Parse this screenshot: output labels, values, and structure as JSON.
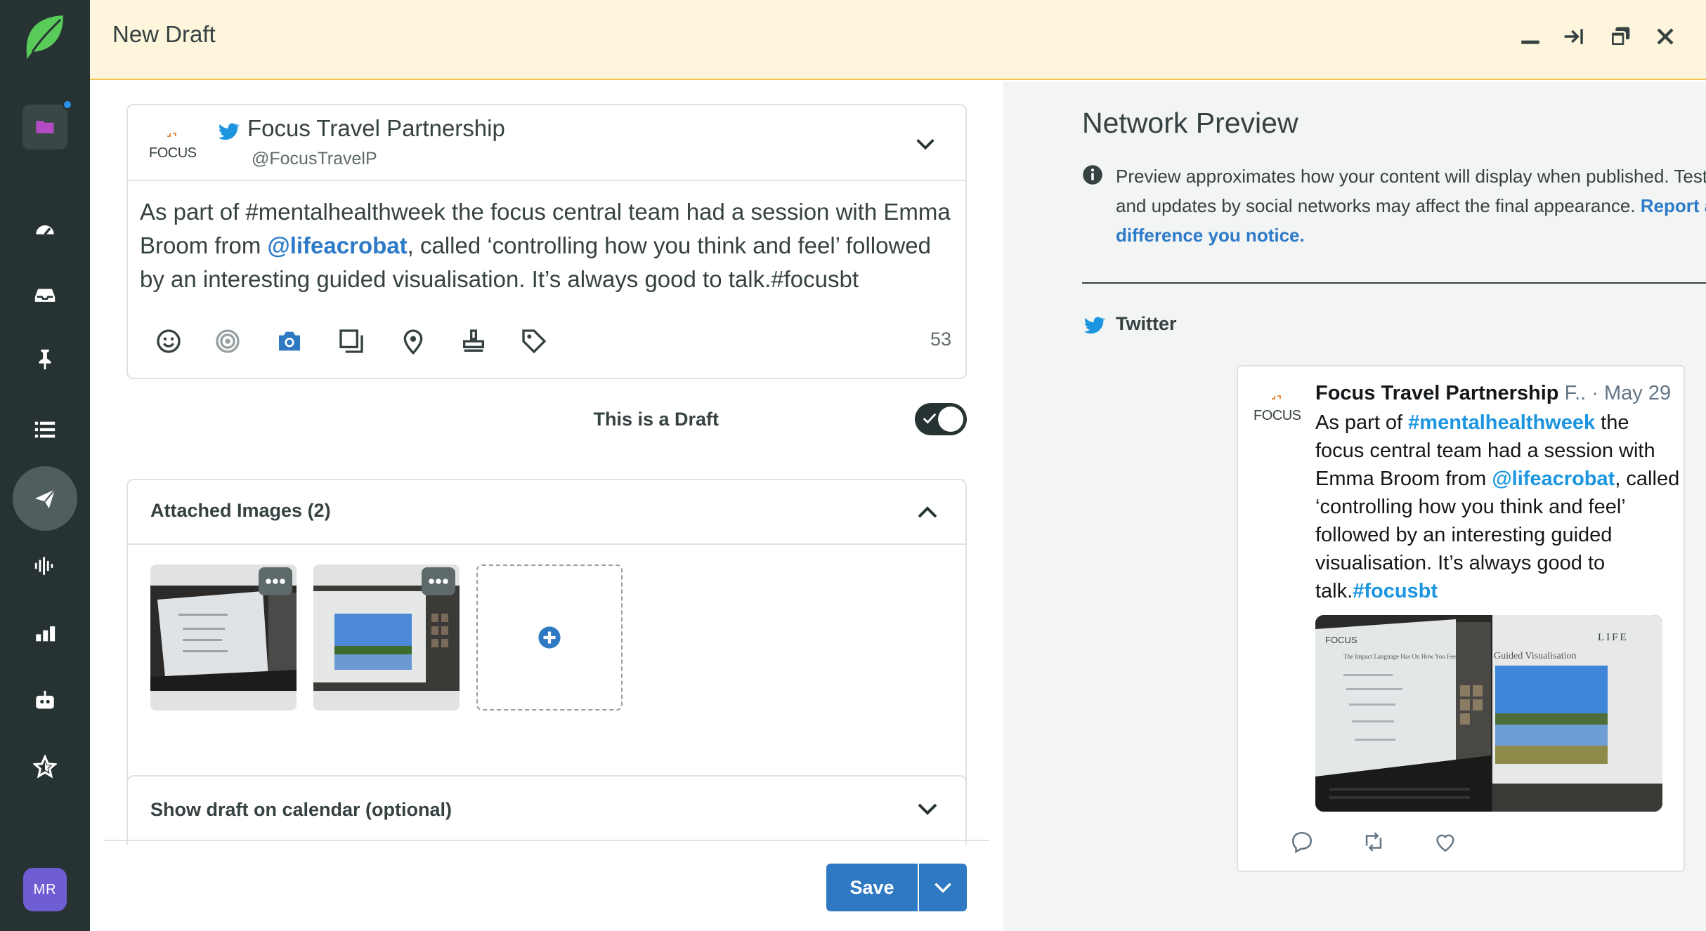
{
  "header": {
    "title": "New Draft"
  },
  "sidebar": {
    "items": [
      {
        "name": "folder-icon"
      },
      {
        "name": "dashboard-icon"
      },
      {
        "name": "inbox-icon"
      },
      {
        "name": "pin-icon"
      },
      {
        "name": "list-icon"
      },
      {
        "name": "send-icon",
        "active": true
      },
      {
        "name": "listening-icon"
      },
      {
        "name": "reports-icon"
      },
      {
        "name": "bot-icon"
      },
      {
        "name": "star-icon"
      }
    ],
    "avatar_initials": "MR"
  },
  "composer": {
    "account_name": "Focus Travel Partnership",
    "account_handle": "@FocusTravelP",
    "logo_text": "FOCUS",
    "text_before": "As part of #mentalhealthweek the focus central team had a session with Emma Broom from ",
    "mention": "@lifeacrobat",
    "text_after": ", called ‘controlling how you think and feel’ followed by an interesting guided visualisation. It’s always good to talk.#focusbt",
    "char_count": "53",
    "tools": [
      "emoji-icon",
      "target-icon",
      "camera-icon",
      "gallery-icon",
      "location-icon",
      "stamp-icon",
      "tag-icon"
    ]
  },
  "draft_toggle": {
    "label": "This is a Draft",
    "on": true
  },
  "attached_images": {
    "header": "Attached Images (2)",
    "count": 2
  },
  "calendar": {
    "label": "Show draft on calendar (optional)"
  },
  "actions": {
    "save_label": "Save"
  },
  "preview": {
    "title": "Network Preview",
    "desc": "Preview approximates how your content will display when published. Tests and updates by social networks may affect the final appearance.",
    "link": "Report a difference you notice.",
    "network": "Twitter",
    "tweet": {
      "name": "Focus Travel Partnership",
      "handle_trunc": "F..",
      "sep": "·",
      "date": "May 29",
      "p1": "As part of ",
      "tag1": "#mentalhealthweek",
      "p2": " the focus central team had a session with Emma Broom from ",
      "mention": "@lifeacrobat",
      "p3": ", called ‘controlling how you think and feel’ followed by an interesting guided visualisation. It’s always good to talk.",
      "tag2": "#focusbt",
      "slide1_title": "The Impact Language Has On How You Feel",
      "slide2_title": "Guided Visualisation",
      "slide2_brand": "LIFE"
    }
  },
  "colors": {
    "sidebar": "#273333",
    "accent_blue": "#2f79c3",
    "header_bg": "#fdf6dc",
    "twitter_blue": "#1b95e0"
  }
}
